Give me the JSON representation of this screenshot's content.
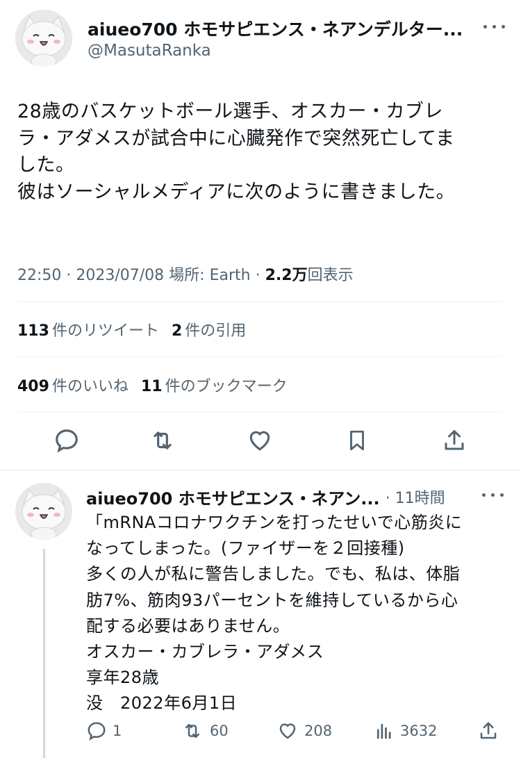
{
  "tweet": {
    "display_name": "aiueo700 ホモサピエンス・ネアンデルター...",
    "handle": "@MasutaRanka",
    "text_lines": [
      "28歳のバスケットボール選手、オスカー・カブレ",
      "ラ・アダメスが試合中に心臓発作で突然死亡してま",
      "した。",
      "彼はソーシャルメディアに次のように書きました。"
    ],
    "timestamp": "22:50 · 2023/07/08",
    "location": "場所: Earth",
    "views_count": "2.2万",
    "views_label": "回表示"
  },
  "stats": {
    "retweets_count": "113",
    "retweets_label": "件のリツイート",
    "quotes_count": "2",
    "quotes_label": "件の引用",
    "likes_count": "409",
    "likes_label": "件のいいね",
    "bookmarks_count": "11",
    "bookmarks_label": "件のブックマーク"
  },
  "actions": {
    "icons": [
      "reply-icon",
      "retweet-icon",
      "like-icon",
      "bookmark-icon",
      "share-icon"
    ]
  },
  "reply": {
    "display_name": "aiueo700 ホモサピエンス・ネアン...",
    "time": "· 11時間",
    "text_lines": [
      "「mRNAコロナワクチンを打ったせいで心筋炎に",
      "なってしまった。(ファイザーを２回接種)",
      "多くの人が私に警告しました。でも、私は、体脂",
      "肪7%、筋肉93パーセントを維持しているから心",
      "配する必要はありません。",
      "オスカー・カブレラ・アダメス",
      "享年28歳",
      "没　2022年6月1日"
    ],
    "replies": "1",
    "retweets": "60",
    "likes": "208",
    "views": "3632"
  },
  "colors": {
    "text": "#0f1419",
    "secondary": "#536471",
    "divider": "#eff3f4",
    "thread_line": "#cfd9de"
  }
}
